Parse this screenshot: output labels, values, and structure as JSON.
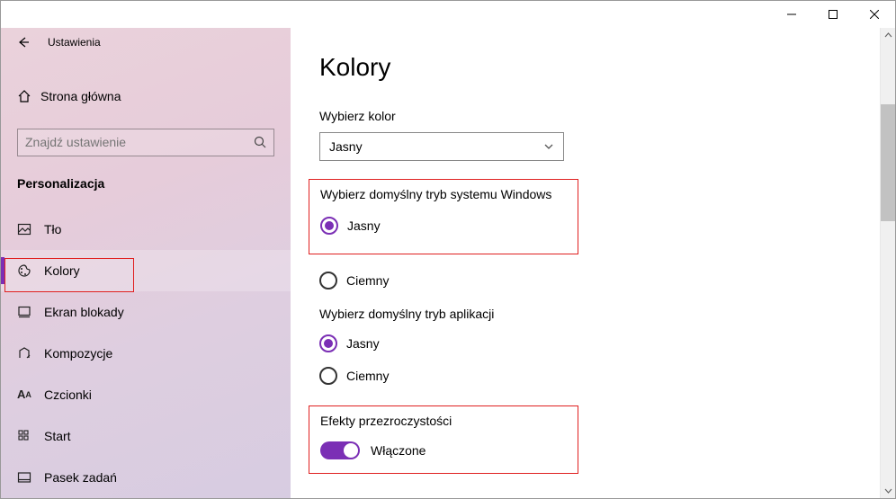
{
  "window": {
    "app_title": "Ustawienia"
  },
  "sidebar": {
    "home_label": "Strona główna",
    "search_placeholder": "Znajdź ustawienie",
    "category_label": "Personalizacja",
    "items": [
      {
        "label": "Tło"
      },
      {
        "label": "Kolory"
      },
      {
        "label": "Ekran blokady"
      },
      {
        "label": "Kompozycje"
      },
      {
        "label": "Czcionki"
      },
      {
        "label": "Start"
      },
      {
        "label": "Pasek zadań"
      }
    ]
  },
  "main": {
    "title": "Kolory",
    "choose_color_label": "Wybierz kolor",
    "choose_color_value": "Jasny",
    "windows_mode": {
      "title": "Wybierz domyślny tryb systemu Windows",
      "light": "Jasny",
      "dark": "Ciemny"
    },
    "app_mode": {
      "title": "Wybierz domyślny tryb aplikacji",
      "light": "Jasny",
      "dark": "Ciemny"
    },
    "transparency": {
      "title": "Efekty przezroczystości",
      "state": "Włączone"
    }
  }
}
